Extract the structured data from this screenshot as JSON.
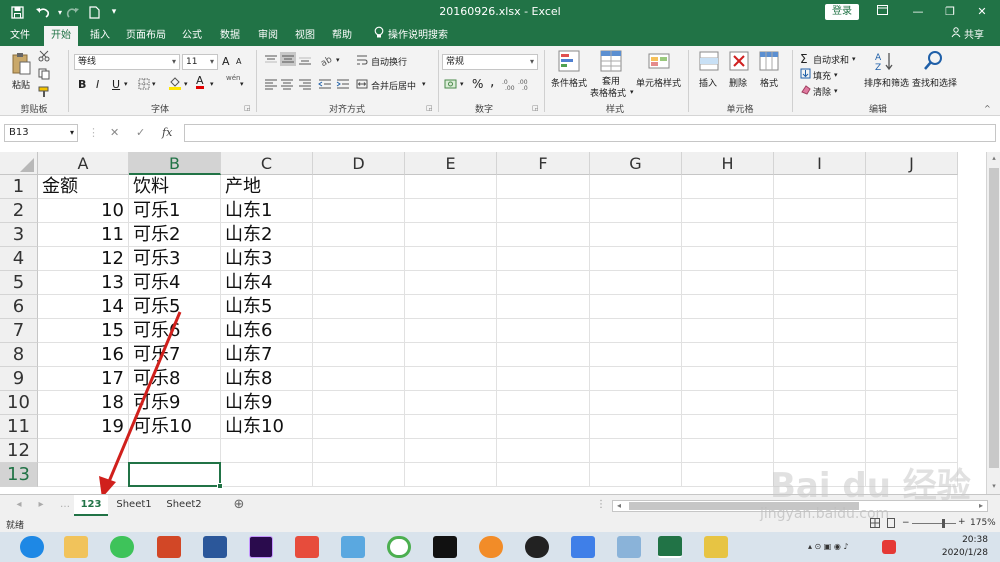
{
  "titlebar": {
    "title": "20160926.xlsx - Excel",
    "login": "登录",
    "minimize": "—",
    "restore": "❐",
    "close": "✕"
  },
  "tabs": [
    "文件",
    "开始",
    "插入",
    "页面布局",
    "公式",
    "数据",
    "审阅",
    "视图",
    "帮助",
    "操作说明搜索"
  ],
  "share": "共享",
  "ribbon": {
    "clipboard": {
      "label": "剪贴板",
      "paste": "粘贴"
    },
    "font": {
      "label": "字体",
      "name": "等线",
      "size": "11",
      "bold": "B",
      "italic": "I",
      "underline": "U",
      "grow": "A",
      "shrink": "A",
      "fontcolor": "A",
      "wen": "wén"
    },
    "alignment": {
      "label": "对齐方式",
      "wrap": "自动换行",
      "merge": "合并后居中"
    },
    "number": {
      "label": "数字",
      "format": "常规",
      "percent": "%",
      "comma": ","
    },
    "styles": {
      "label": "样式",
      "cond": "条件格式",
      "table": "套用\n表格格式",
      "table1": "套用",
      "table2": "表格格式",
      "cell": "单元格样式"
    },
    "cells": {
      "label": "单元格",
      "insert": "插入",
      "delete": "删除",
      "format": "格式"
    },
    "editing": {
      "label": "编辑",
      "autosum": "自动求和",
      "fill": "填充",
      "clear": "清除",
      "sort": "排序和筛选",
      "find": "查找和选择"
    }
  },
  "formula_bar": {
    "namebox": "B13",
    "cancel": "✕",
    "enter": "✓",
    "fx": "fx",
    "value": ""
  },
  "columns": [
    "A",
    "B",
    "C",
    "D",
    "E",
    "F",
    "G",
    "H",
    "I",
    "J"
  ],
  "rows": [
    "1",
    "2",
    "3",
    "4",
    "5",
    "6",
    "7",
    "8",
    "9",
    "10",
    "11",
    "12",
    "13"
  ],
  "cells": {
    "A": [
      "金额",
      "10",
      "11",
      "12",
      "13",
      "14",
      "15",
      "16",
      "17",
      "18",
      "19",
      "",
      ""
    ],
    "B": [
      "饮料",
      "可乐1",
      "可乐2",
      "可乐3",
      "可乐4",
      "可乐5",
      "可乐6",
      "可乐7",
      "可乐8",
      "可乐9",
      "可乐10",
      "",
      ""
    ],
    "C": [
      "产地",
      "山东1",
      "山东2",
      "山东3",
      "山东4",
      "山东5",
      "山东6",
      "山东7",
      "山东8",
      "山东9",
      "山东10",
      "",
      ""
    ]
  },
  "sheets": [
    "123",
    "Sheet1",
    "Sheet2"
  ],
  "add_sheet": "⊕",
  "status": {
    "ready": "就绪",
    "zoom": "175%",
    "zoom_minus": "−",
    "zoom_plus": "+"
  },
  "taskbar": {
    "time": "20:38",
    "date": "2020/1/28"
  },
  "watermark": {
    "brand": "Bai du 经验",
    "url": "jingyan.baidu.com"
  },
  "colors": {
    "excel_green": "#217346",
    "arrow_red": "#d0201c"
  }
}
